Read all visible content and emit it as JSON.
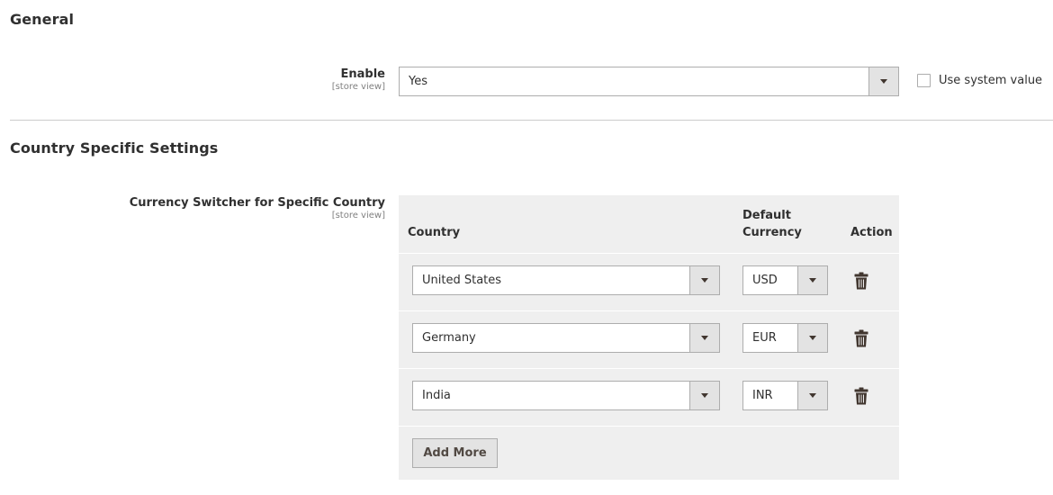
{
  "general": {
    "title": "General",
    "enable": {
      "label": "Enable",
      "scope": "[store view]",
      "value": "Yes"
    },
    "use_system_value": {
      "label": "Use system value",
      "checked": false
    }
  },
  "country_settings": {
    "title": "Country Specific Settings",
    "currency_switcher": {
      "label": "Currency Switcher for Specific Country",
      "scope": "[store view]",
      "columns": {
        "country": "Country",
        "default_currency_line1": "Default",
        "default_currency_line2": "Currency",
        "action": "Action"
      },
      "rows": [
        {
          "country": "United States",
          "currency": "USD"
        },
        {
          "country": "Germany",
          "currency": "EUR"
        },
        {
          "country": "India",
          "currency": "INR"
        }
      ],
      "add_more_label": "Add More"
    }
  },
  "icons": {
    "dropdown": "chevron-down-icon",
    "delete": "trash-icon"
  }
}
